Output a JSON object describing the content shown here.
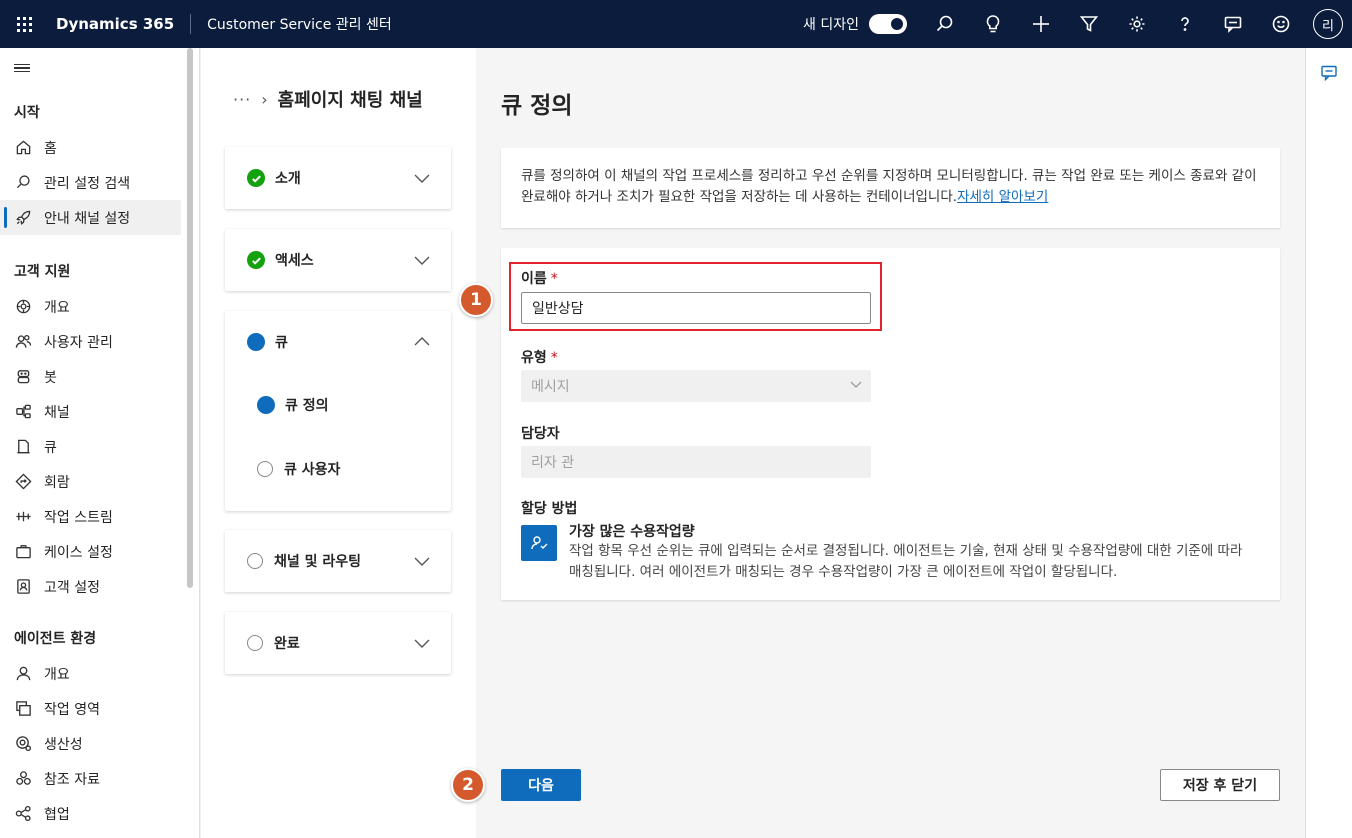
{
  "header": {
    "brand": "Dynamics 365",
    "app_name": "Customer Service 관리 센터",
    "new_design_label": "새 디자인",
    "new_design_on": true,
    "avatar_initial": "리",
    "icons": [
      "search-icon",
      "lightbulb-icon",
      "plus-icon",
      "filter-icon",
      "settings-icon",
      "help-icon",
      "feedback-icon",
      "smiley-icon"
    ]
  },
  "sidebar": {
    "sections": [
      {
        "title": "시작",
        "items": [
          {
            "label": "홈",
            "icon": "home-icon"
          },
          {
            "label": "관리 설정 검색",
            "icon": "search-icon"
          },
          {
            "label": "안내 채널 설정",
            "icon": "rocket-icon",
            "active": true
          }
        ]
      },
      {
        "title": "고객 지원",
        "items": [
          {
            "label": "개요",
            "icon": "overview-icon"
          },
          {
            "label": "사용자 관리",
            "icon": "people-icon"
          },
          {
            "label": "봇",
            "icon": "bot-icon"
          },
          {
            "label": "채널",
            "icon": "channel-icon"
          },
          {
            "label": "큐",
            "icon": "queue-icon"
          },
          {
            "label": "회람",
            "icon": "routing-icon"
          },
          {
            "label": "작업 스트림",
            "icon": "workstream-icon"
          },
          {
            "label": "케이스 설정",
            "icon": "briefcase-icon"
          },
          {
            "label": "고객 설정",
            "icon": "contact-icon"
          }
        ]
      },
      {
        "title": "에이전트 환경",
        "items": [
          {
            "label": "개요",
            "icon": "person-icon"
          },
          {
            "label": "작업 영역",
            "icon": "workspace-icon"
          },
          {
            "label": "생산성",
            "icon": "productivity-icon"
          },
          {
            "label": "참조 자료",
            "icon": "knowledge-icon"
          },
          {
            "label": "협업",
            "icon": "collaboration-icon"
          }
        ]
      }
    ]
  },
  "wizard": {
    "breadcrumb_ellipsis": "···",
    "breadcrumb_current": "홈페이지 채팅 채널",
    "steps": [
      {
        "label": "소개",
        "state": "done"
      },
      {
        "label": "액세스",
        "state": "done"
      },
      {
        "label": "큐",
        "state": "current",
        "substeps": [
          {
            "label": "큐 정의",
            "state": "current"
          },
          {
            "label": "큐 사용자",
            "state": "todo"
          }
        ]
      },
      {
        "label": "채널 및 라우팅",
        "state": "todo"
      },
      {
        "label": "완료",
        "state": "todo"
      }
    ]
  },
  "main": {
    "title": "큐 정의",
    "info_text": "큐를 정의하여 이 채널의 작업 프로세스를 정리하고 우선 순위를 지정하며 모니터링합니다. 큐는 작업 완료 또는 케이스 종료와 같이 완료해야 하거나 조치가 필요한 작업을 저장하는 데 사용하는 컨테이너입니다.",
    "info_link": "자세히 알아보기",
    "form": {
      "name_label": "이름",
      "name_value": "일반상담",
      "type_label": "유형",
      "type_value": "메시지",
      "owner_label": "담당자",
      "owner_value": "리자 관",
      "assign_label": "할당 방법",
      "assign_title": "가장 많은 수용작업량",
      "assign_desc": "작업 항목 우선 순위는 큐에 입력되는 순서로 결정됩니다. 에이전트는 기술, 현재 상태 및 수용작업량에 대한 기준에 따라 매칭됩니다. 여러 에이전트가 매칭되는 경우 수용작업량이 가장 큰 에이전트에 작업이 할당됩니다.",
      "required_mark": "*"
    },
    "badges": [
      "1",
      "2"
    ],
    "next_button": "다음",
    "save_close_button": "저장 후 닫기"
  }
}
